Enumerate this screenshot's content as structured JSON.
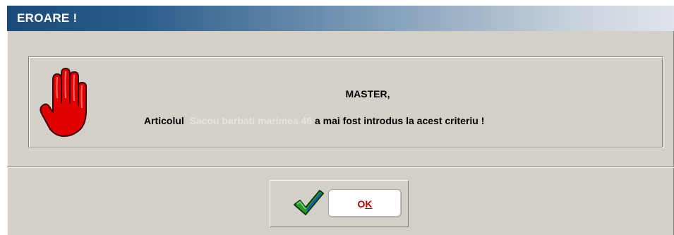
{
  "dialog": {
    "title": "EROARE !",
    "message": {
      "line1": "MASTER,",
      "line2_prefix": "Articolul",
      "line2_highlight": "Sacou barbati marimea 46",
      "line2_suffix": "a mai fost introdus la acest criteriu !"
    },
    "ok_button": {
      "label_main": "O",
      "label_accel": "K"
    },
    "icons": {
      "stop": "stop-hand-icon",
      "confirm": "checkmark-icon"
    },
    "colors": {
      "title_bar_start": "#1a4a7a",
      "title_bar_end": "#dfe4ea",
      "dialog_bg": "#d4d0c8",
      "hand_red": "#e00000",
      "check_green": "#2e9a2e",
      "ok_text": "#b00000"
    }
  }
}
